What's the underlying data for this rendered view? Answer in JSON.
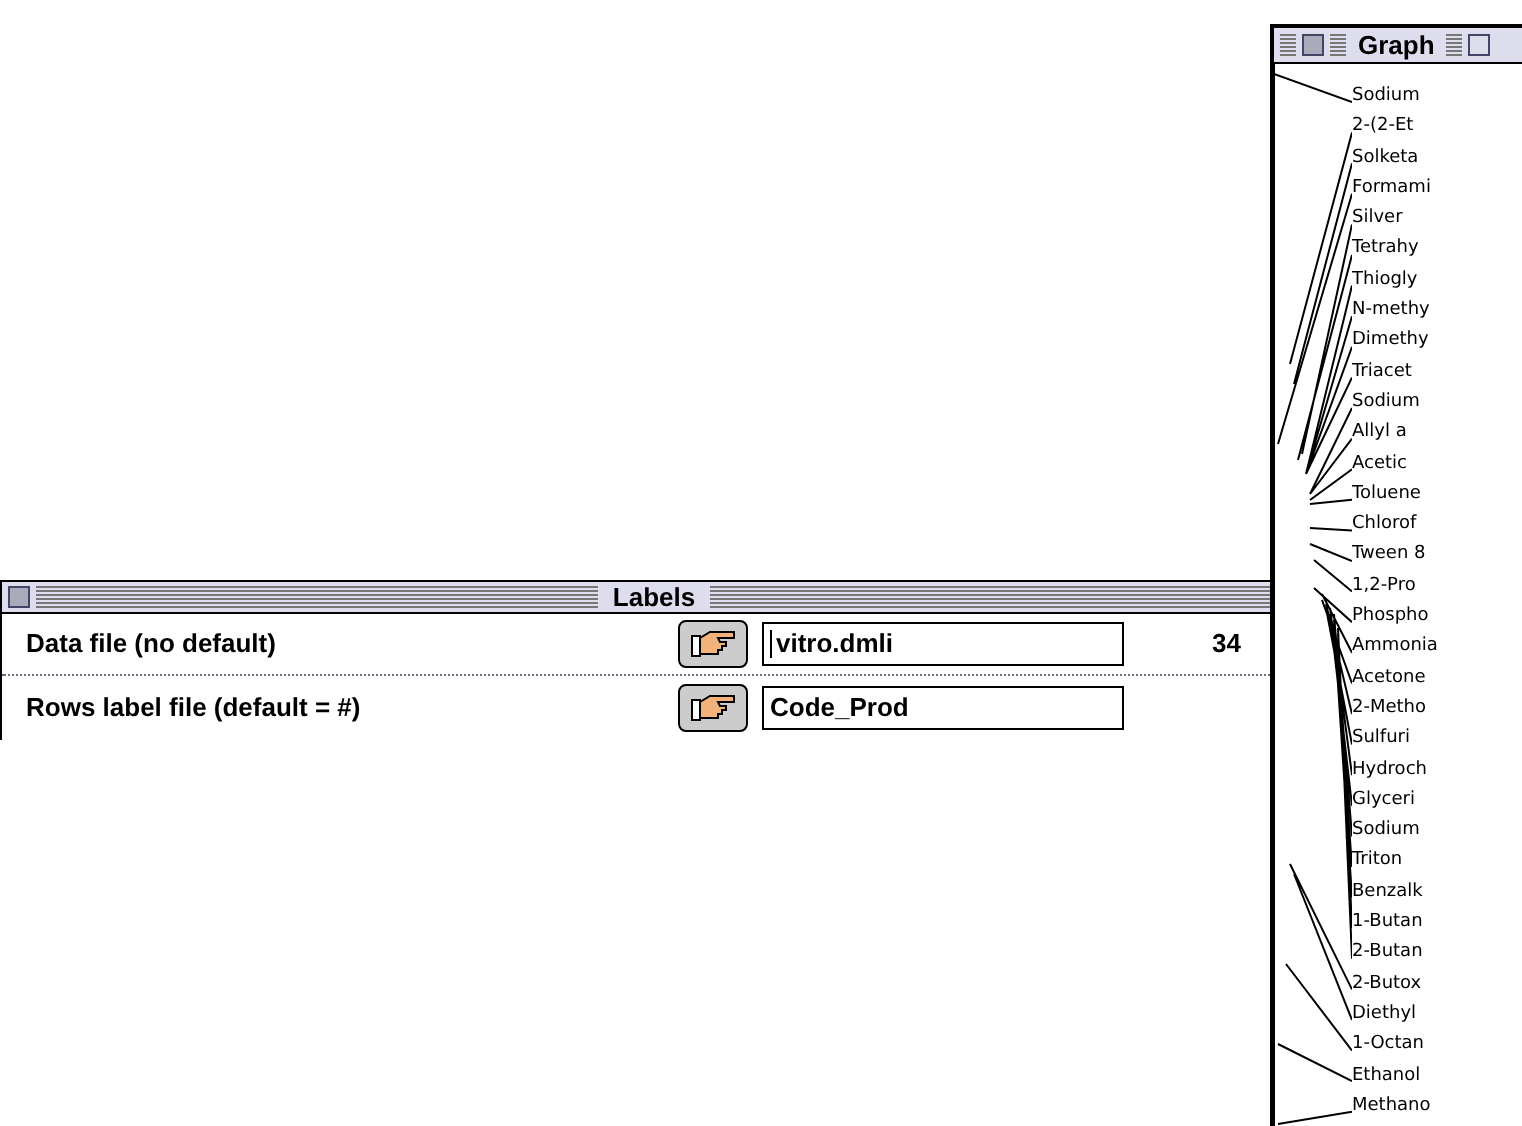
{
  "labels_window": {
    "title": "Labels",
    "rows": [
      {
        "label": "Data file (no default)",
        "value": "vitro.dmli",
        "focused": true,
        "count": "34"
      },
      {
        "label": "Rows label file (default = #)",
        "value": "Code_Prod",
        "focused": false
      }
    ]
  },
  "graph_window": {
    "title": "Graph",
    "leaves": [
      "Sodium",
      "2-(2-Et",
      "Solketa",
      "Formami",
      "Silver",
      "Tetrahy",
      "Thiogly",
      "N-methy",
      "Dimethy",
      "Triacet",
      "Sodium",
      "Allyl a",
      "Acetic",
      "Toluene",
      "Chlorof",
      "Tween 8",
      "1,2-Pro",
      "Phospho",
      "Ammonia",
      "Acetone",
      "2-Metho",
      "Sulfuri",
      "Hydroch",
      "Glyceri",
      "Sodium",
      "Triton",
      "Benzalk",
      "1-Butan",
      "2-Butan",
      "2-Butox",
      "Diethyl",
      "1-Octan",
      "Ethanol",
      "Methano"
    ]
  }
}
